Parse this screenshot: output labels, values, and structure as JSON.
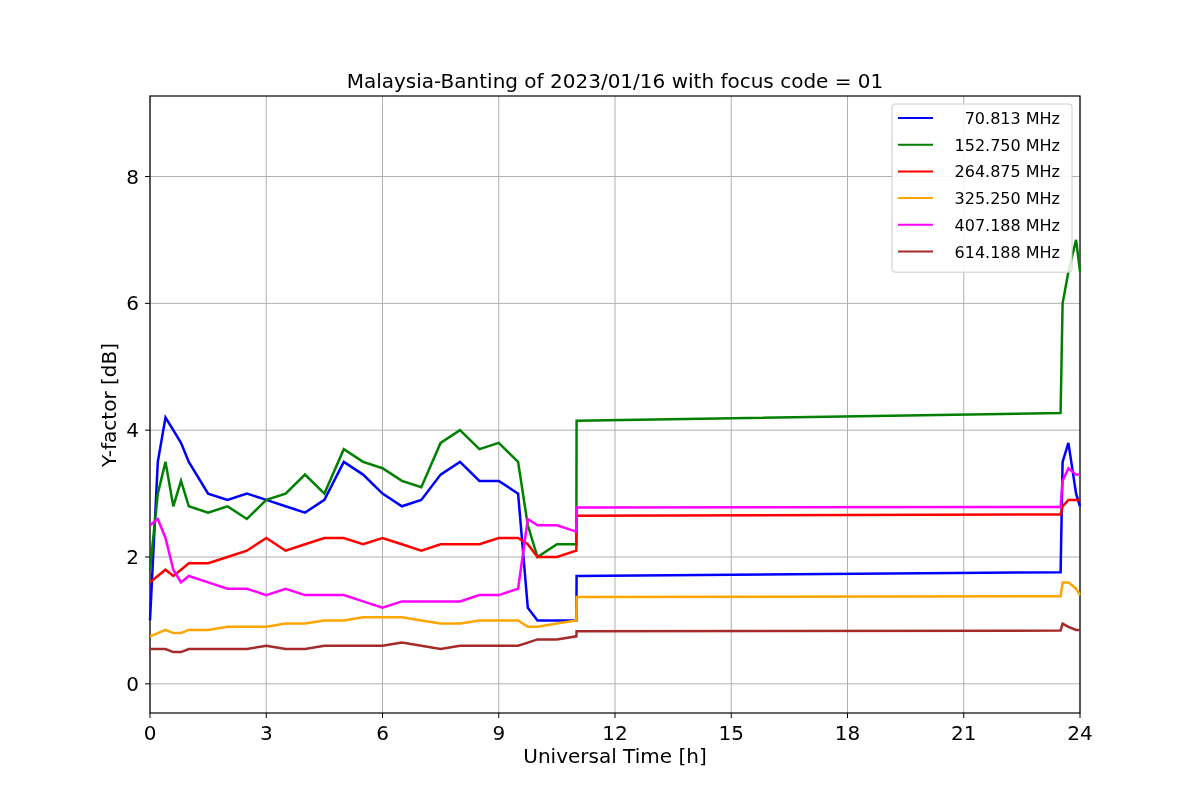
{
  "chart_data": {
    "type": "line",
    "title": "Malaysia-Banting of 2023/01/16 with focus code = 01",
    "xlabel": "Universal Time [h]",
    "ylabel": "Y-factor [dB]",
    "x": [
      0,
      0.2,
      0.4,
      0.6,
      0.8,
      1,
      1.5,
      2,
      2.5,
      3,
      3.5,
      4,
      4.5,
      5,
      5.5,
      6,
      6.5,
      7,
      7.5,
      8,
      8.5,
      9,
      9.5,
      9.75,
      10,
      10.5,
      11,
      11.01,
      23.5,
      23.55,
      23.7,
      23.9,
      24
    ],
    "grid": true,
    "legend": true,
    "xlim": [
      0,
      24
    ],
    "ylim": [
      -0.46,
      9.27
    ],
    "xticks": [
      0,
      3,
      6,
      9,
      12,
      15,
      18,
      21,
      24
    ],
    "yticks": [
      0,
      2,
      4,
      6,
      8
    ],
    "series": [
      {
        "name": "70.813 MHz",
        "color": "#0000ff",
        "values": [
          1.0,
          3.5,
          4.2,
          4.0,
          3.8,
          3.5,
          3.0,
          2.9,
          3.0,
          2.9,
          2.8,
          2.7,
          2.9,
          3.5,
          3.3,
          3.0,
          2.8,
          2.9,
          3.3,
          3.5,
          3.2,
          3.2,
          3.0,
          1.2,
          1.0,
          1.0,
          1.0,
          1.7,
          1.76,
          3.5,
          3.8,
          3.0,
          2.8
        ]
      },
      {
        "name": "152.750 MHz",
        "color": "#008000",
        "values": [
          1.8,
          3.0,
          3.5,
          2.8,
          3.2,
          2.8,
          2.7,
          2.8,
          2.6,
          2.9,
          3.0,
          3.3,
          3.0,
          3.7,
          3.5,
          3.4,
          3.2,
          3.1,
          3.8,
          4.0,
          3.7,
          3.8,
          3.5,
          2.5,
          2.0,
          2.2,
          2.2,
          4.15,
          4.27,
          6.0,
          6.5,
          7.0,
          6.5
        ]
      },
      {
        "name": "264.875 MHz",
        "color": "#ff0000",
        "values": [
          1.6,
          1.7,
          1.8,
          1.7,
          1.8,
          1.9,
          1.9,
          2.0,
          2.1,
          2.3,
          2.1,
          2.2,
          2.3,
          2.3,
          2.2,
          2.3,
          2.2,
          2.1,
          2.2,
          2.2,
          2.2,
          2.3,
          2.3,
          2.2,
          2.0,
          2.0,
          2.1,
          2.65,
          2.67,
          2.8,
          2.9,
          2.9,
          2.9
        ]
      },
      {
        "name": "325.250 MHz",
        "color": "#ffa500",
        "values": [
          0.75,
          0.8,
          0.85,
          0.8,
          0.8,
          0.85,
          0.85,
          0.9,
          0.9,
          0.9,
          0.95,
          0.95,
          1.0,
          1.0,
          1.05,
          1.05,
          1.05,
          1.0,
          0.95,
          0.95,
          1.0,
          1.0,
          1.0,
          0.9,
          0.9,
          0.95,
          1.0,
          1.37,
          1.38,
          1.6,
          1.6,
          1.5,
          1.4
        ]
      },
      {
        "name": "407.188 MHz",
        "color": "#ff00ff",
        "values": [
          2.5,
          2.6,
          2.3,
          1.8,
          1.6,
          1.7,
          1.6,
          1.5,
          1.5,
          1.4,
          1.5,
          1.4,
          1.4,
          1.4,
          1.3,
          1.2,
          1.3,
          1.3,
          1.3,
          1.3,
          1.4,
          1.4,
          1.5,
          2.6,
          2.5,
          2.5,
          2.4,
          2.78,
          2.79,
          3.2,
          3.4,
          3.3,
          3.3
        ]
      },
      {
        "name": "614.188 MHz",
        "color": "#a52a2a",
        "values": [
          0.55,
          0.55,
          0.55,
          0.5,
          0.5,
          0.55,
          0.55,
          0.55,
          0.55,
          0.6,
          0.55,
          0.55,
          0.6,
          0.6,
          0.6,
          0.6,
          0.65,
          0.6,
          0.55,
          0.6,
          0.6,
          0.6,
          0.6,
          0.65,
          0.7,
          0.7,
          0.75,
          0.83,
          0.84,
          0.95,
          0.9,
          0.85,
          0.85
        ]
      }
    ]
  }
}
